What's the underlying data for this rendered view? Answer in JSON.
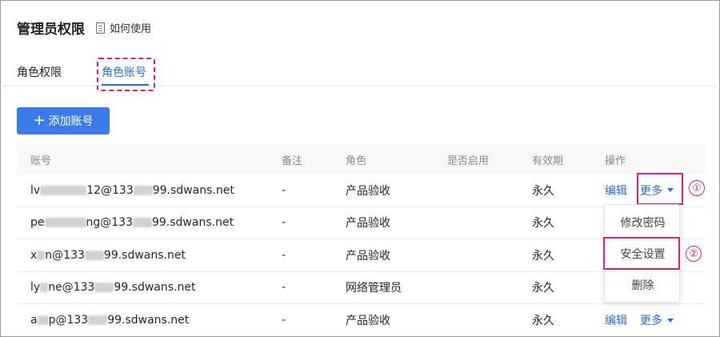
{
  "header": {
    "title": "管理员权限",
    "help_label": "如何使用"
  },
  "tabs": [
    {
      "label": "角色权限"
    },
    {
      "label": "角色账号",
      "active": true
    }
  ],
  "toolbar": {
    "add_label": "添加账号",
    "add_icon": "plus-icon"
  },
  "table": {
    "columns": [
      "账号",
      "备注",
      "角色",
      "是否启用",
      "有效期",
      "操作"
    ],
    "rows": [
      {
        "acc_a": "lv",
        "acc_b": "12@133",
        "acc_c": "99.sdwans.net",
        "note": "-",
        "role": "产品验收",
        "enabled": true,
        "expiry": "永久",
        "edit": "编辑",
        "more": "更多"
      },
      {
        "acc_a": "pe",
        "acc_b": "ng@133",
        "acc_c": "99.sdwans.net",
        "note": "-",
        "role": "产品验收",
        "enabled": true,
        "expiry": "永久"
      },
      {
        "acc_a": "x",
        "acc_b": "n@133",
        "acc_c": "99.sdwans.net",
        "note": "-",
        "role": "产品验收",
        "enabled": true,
        "expiry": "永久"
      },
      {
        "acc_a": "ly",
        "acc_b": "ne@133",
        "acc_c": "99.sdwans.net",
        "note": "-",
        "role": "网络管理员",
        "enabled": true,
        "expiry": "永久"
      },
      {
        "acc_a": "a",
        "acc_b": "p@133",
        "acc_c": "99.sdwans.net",
        "note": "-",
        "role": "产品验收",
        "enabled": true,
        "expiry": "永久",
        "edit": "编辑",
        "more": "更多"
      }
    ]
  },
  "dropdown": {
    "items": [
      "修改密码",
      "安全设置",
      "删除"
    ]
  },
  "annotations": {
    "badge_1": "①",
    "badge_2": "②"
  },
  "colors": {
    "primary": "#3a7be8",
    "link": "#2a6fd6",
    "highlight": "#e0245e"
  }
}
